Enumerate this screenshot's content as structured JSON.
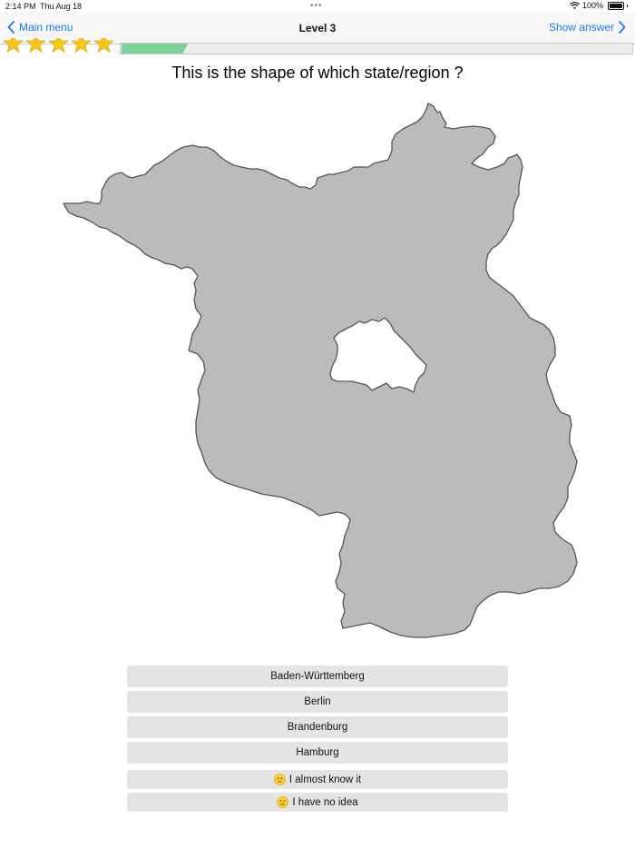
{
  "status_bar": {
    "time": "2:14 PM",
    "date": "Thu Aug 18",
    "dots": "•••",
    "battery_text": "100%"
  },
  "nav": {
    "back_label": "Main menu",
    "title": "Level 3",
    "show_answer_label": "Show answer"
  },
  "stars": {
    "count": 5,
    "filled": 5,
    "color": "#f5c518"
  },
  "progress": {
    "fraction": 0.13,
    "fill_color": "#7ed198"
  },
  "question": "This is the shape of which state/region ?",
  "map": {
    "fill_color": "#bbbbbb",
    "stroke_color": "#555555"
  },
  "answers": [
    {
      "label": "Baden-Württemberg"
    },
    {
      "label": "Berlin"
    },
    {
      "label": "Brandenburg"
    },
    {
      "label": "Hamburg"
    }
  ],
  "extra_options": [
    {
      "label": "I almost know it",
      "icon": "confused-face-icon"
    },
    {
      "label": "I have no idea",
      "icon": "disappointed-face-icon"
    }
  ]
}
